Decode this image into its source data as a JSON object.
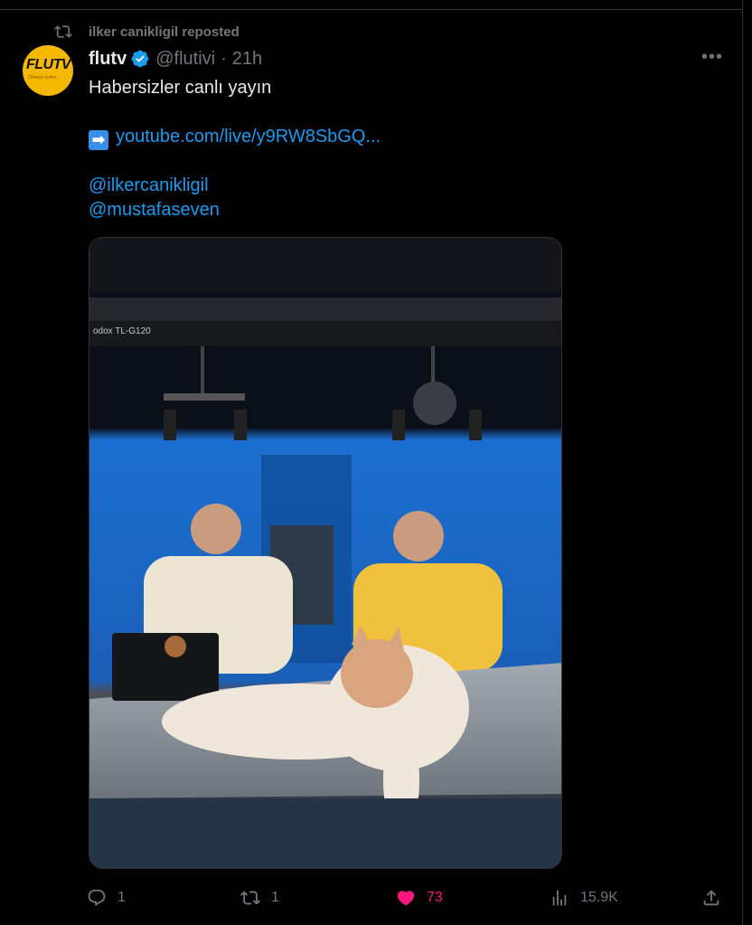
{
  "repost": {
    "text": "ilker canikligil reposted"
  },
  "tweet": {
    "author_name": "flutv",
    "handle": "@flutivi",
    "separator": "·",
    "time": "21h",
    "more_label": "•••",
    "avatar": {
      "logo_text": "FLUTV",
      "logo_sub": "Ölmeye İçelim"
    },
    "text_line1": "Habersizler canlı yayın",
    "link_emoji": "➡",
    "link": "youtube.com/live/y9RW8SbGQ...",
    "mention1": "@ilkercanikligil",
    "mention2": "@mustafaseven",
    "media": {
      "light_label": "odox  TL-G120",
      "description_icon": "photo"
    }
  },
  "actions": {
    "reply_count": "1",
    "repost_count": "1",
    "like_count": "73",
    "views_count": "15.9K"
  },
  "colors": {
    "accent": "#1d9bf0",
    "like": "#f91880",
    "muted": "#71767b",
    "text": "#e7e9ea"
  }
}
